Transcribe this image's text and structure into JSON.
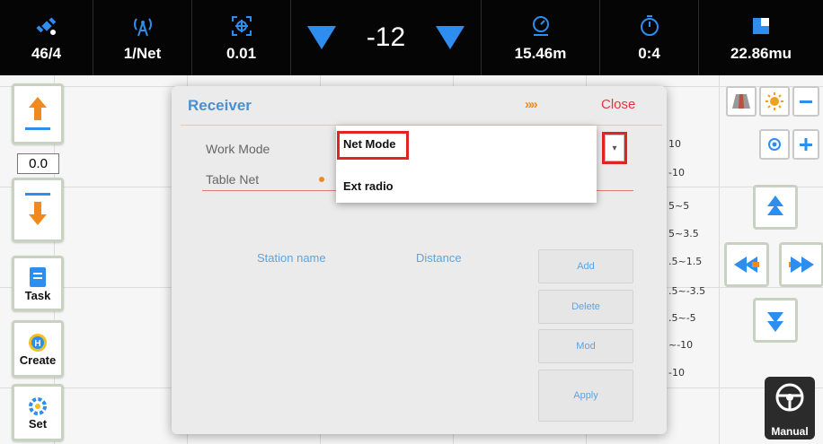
{
  "status_bar": {
    "satellites": "46/4",
    "network": "1/Net",
    "accuracy": "0.01",
    "offset_value": "-12",
    "speed": "15.46m",
    "time": "0:4",
    "area": "22.86mu"
  },
  "left_toolbar": {
    "offset_value": "0.0",
    "task_label": "Task",
    "create_label": "Create",
    "set_label": "Set"
  },
  "right_panel": {
    "legend": [
      "10",
      "-10",
      "5~5",
      "5~3.5",
      ".5~1.5",
      ".5~-3.5",
      ".5~-5",
      "~-10",
      "-10"
    ],
    "manual_label": "Manual"
  },
  "dialog": {
    "title": "Receiver",
    "forward_arrows": "»»",
    "close_label": "Close",
    "work_mode_label": "Work Mode",
    "table_net_label": "Table Net",
    "columns": [
      "Station name",
      "Distance"
    ],
    "buttons": {
      "add": "Add",
      "delete": "Delete",
      "mod": "Mod",
      "apply": "Apply"
    }
  },
  "dropdown": {
    "options": [
      "Net Mode",
      "Ext radio"
    ],
    "selected": "Net Mode"
  },
  "colors": {
    "accent_blue": "#2d8ef0",
    "title_blue": "#4a90d0",
    "close_red": "#e8353a",
    "orange": "#f08a1e",
    "highlight_red": "#e02424"
  }
}
